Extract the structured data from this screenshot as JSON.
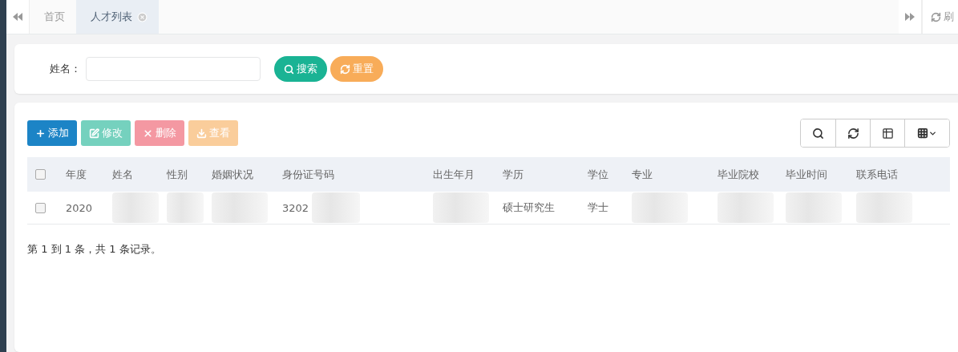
{
  "tabs_bar": {
    "tabs": [
      {
        "label": "首页",
        "selected": false,
        "closable": false
      },
      {
        "label": "人才列表",
        "selected": true,
        "closable": true
      }
    ],
    "refresh_label": "刷"
  },
  "search_form": {
    "label": "姓名：",
    "search_button": "搜索",
    "reset_button": "重置"
  },
  "toolbar": {
    "buttons": [
      {
        "kind": "add",
        "label": "添加",
        "disabled": false
      },
      {
        "kind": "edit",
        "label": "修改",
        "disabled": true
      },
      {
        "kind": "delete",
        "label": "删除",
        "disabled": true
      },
      {
        "kind": "export",
        "label": "查看",
        "disabled": true
      }
    ]
  },
  "table": {
    "select_all_checked": false,
    "columns": [
      "年度",
      "姓名",
      "性别",
      "婚姻状况",
      "身份证号码",
      "出生年月",
      "学历",
      "学位",
      "专业",
      "毕业院校",
      "毕业时间",
      "联系电话"
    ],
    "rows": [
      {
        "checked": false,
        "cells": [
          {
            "kind": "text",
            "text": "2020"
          },
          {
            "kind": "redacted"
          },
          {
            "kind": "redacted"
          },
          {
            "kind": "redacted"
          },
          {
            "kind": "partial",
            "text": "3202"
          },
          {
            "kind": "redacted"
          },
          {
            "kind": "text",
            "text": "硕士研究生"
          },
          {
            "kind": "text",
            "text": "学士"
          },
          {
            "kind": "redacted"
          },
          {
            "kind": "redacted"
          },
          {
            "kind": "redacted"
          },
          {
            "kind": "redacted"
          }
        ]
      }
    ]
  },
  "pagination_info": "第 1 到 1 条，共 1 条记录。"
}
